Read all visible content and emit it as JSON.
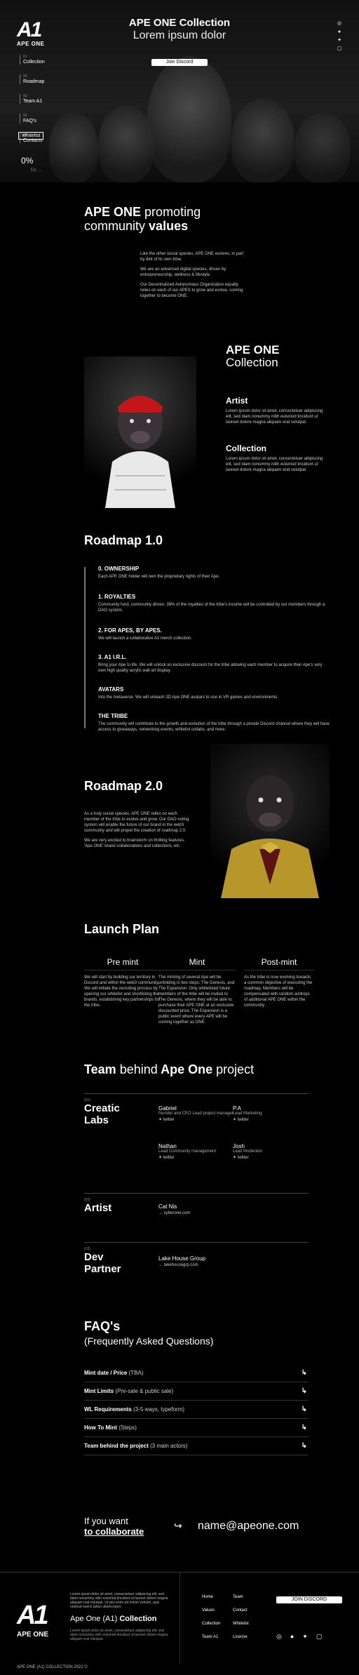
{
  "hero": {
    "logo_mark": "A1",
    "logo_text": "APE ONE",
    "title": "APE ONE Collection",
    "subtitle": "Lorem ipsum dolor",
    "join_label": "Join Discord",
    "whitelist_label": "Whitelist",
    "progress_label": "0%",
    "progress_value": 0,
    "progress_sub": "Ed. ...",
    "nav": [
      {
        "num": "01",
        "label": "Collection"
      },
      {
        "num": "02",
        "label": "Roadmap"
      },
      {
        "num": "03",
        "label": "Team A1"
      },
      {
        "num": "04",
        "label": "FAQ's"
      },
      {
        "num": "05",
        "label": "Contacts"
      }
    ]
  },
  "promo": {
    "title_a": "APE ONE",
    "title_b": "promoting",
    "title_c": "community",
    "title_d": "values",
    "p1": "Like the other social species, APE ONE evolves, in part by dint of its own tribe.",
    "p2": "We are an advanced digital species, driven by entrepreneurship, wellness & lifestyle.",
    "p3": "Our Decentralized Autonomous Organization equally relies on each of our APES to grow and evolve, coming together to become ONE."
  },
  "collection": {
    "title_a": "APE ONE",
    "title_b": "Collection",
    "artist_h": "Artist",
    "artist_t": "Lorem ipsum dolor sit amet, consectetuer adipiscing elit, sed diam nonummy nibh euismod tincidunt ut laoreet dolore magna aliquam erat volutpat.",
    "collection_h": "Collection",
    "collection_t": "Lorem ipsum dolor sit amet, consectetuer adipiscing elit, sed diam nonummy nibh euismod tincidunt ut laoreet dolore magna aliquam erat volutpat."
  },
  "roadmap1": {
    "title": "Roadmap 1.0",
    "items": [
      {
        "h": "0. OWNERSHIP",
        "t": "Each APE ONE holder will own the proprietary rights of their Ape."
      },
      {
        "h": "1. ROYALTIES",
        "t": "Community fund, community driven. 38% of the royalties of the tribe's income will be controlled by our members through a DAO system."
      },
      {
        "h": "2. FOR APES, BY APES.",
        "t": "We will launch a collaborative A1 merch collection."
      },
      {
        "h": "3. A1 I.R.L.",
        "t": "Bring your Ape to life. We will unlock an exclusive discount for the tribe allowing each member to acquire their Ape's very own high quality acrylic wall art display."
      },
      {
        "h": "AVATARS",
        "t": "Into the metaverse. We will unleash 3D Ape ONE avatars to use in VR games and environments."
      },
      {
        "h": "THE TRIBE",
        "t": "The community will contribute to the growth and evolution of the tribe through a private Discord channel where they will have access to giveaways, networking events, whitelist collabs, and more."
      }
    ]
  },
  "roadmap2": {
    "title": "Roadmap 2.0",
    "p1": "As a truly social species, APE ONE relies on each member of the tribe to evolve and grow. Our DAO voting system will enable the future of our brand in the web3 community and will propel the creation of roadmap 2.0.",
    "p2": "We are very excited to brainstorm on thrilling features. 'Ape ONE' brand collaborations and collections, etc."
  },
  "launch": {
    "title": "Launch Plan",
    "cols": [
      {
        "h": "Pre mint",
        "t": "We will start by building our territory in Discord and within the web3 community. We will initiate the recruiting process by opening our whitelist and shortlisting the brands, establishing key partnerships for the tribe."
      },
      {
        "h": "Mint",
        "t": "The minting of several Ape will be unfolding in two steps: The Genesis, and The Expansion. Only whitelisted future members of the tribe will be invited to The Genesis, where they will be able to purchase their APE ONE at an exclusive discounted price. The Expansion is a public event where every APE will be coming together as ONE."
      },
      {
        "h": "Post-mint",
        "t": "As the tribe is now evolving towards a common objective of executing the roadmap, Members will be compensated with random airdrops of additional APE ONE within the community."
      }
    ]
  },
  "team": {
    "title_a": "Team",
    "title_b": "behind",
    "title_c": "Ape One",
    "title_d": "project",
    "groups": [
      {
        "num": "(01)",
        "name": "Creatic Labs",
        "members": [
          {
            "n": "Gabriel",
            "r": "founder and CEO Lead project manager",
            "l": "twitter"
          },
          {
            "n": "P.A",
            "r": "Lead Marketing",
            "l": "twitter"
          },
          {
            "n": "Nathan",
            "r": "Lead Community management",
            "l": "twitter"
          },
          {
            "n": "Josh",
            "r": "Lead Moderator",
            "l": "twitter"
          }
        ]
      },
      {
        "num": "(02)",
        "name": "Artist",
        "members": [
          {
            "n": "Cat Nis",
            "r": "",
            "l": "cyberone.com"
          }
        ]
      },
      {
        "num": "(03)",
        "name": "Dev Partner",
        "members": [
          {
            "n": "Lake House Group",
            "r": "",
            "l": "lakehousegrp.com"
          }
        ]
      }
    ]
  },
  "faq": {
    "title": "FAQ's",
    "subtitle": "(Frequently Asked Questions)",
    "items": [
      {
        "q": "Mint date / Price",
        "n": "(TBA)"
      },
      {
        "q": "Mint Limits",
        "n": "(Pre-sale & public sale)"
      },
      {
        "q": "WL Requirements",
        "n": "(3-5 ways, typeform)"
      },
      {
        "q": "How To Mint",
        "n": "(Steps)"
      },
      {
        "q": "Team behind the project",
        "n": "(3 main actors)"
      }
    ]
  },
  "collab": {
    "line1": "If you want",
    "line2": "to collaborate",
    "email": "name@apeone.com"
  },
  "footer": {
    "logo_mark": "A1",
    "logo_text": "APE ONE",
    "text": "Lorem ipsum dolor sit amet, consectetuer adipiscing elit, sed diam nonummy nibh euismod tincidunt ut laoreet dolore magna aliquam erat volutpat. Ut wisi enim ad minim veniam, quis nostrud exerci tation ullamcorper.",
    "brand_a": "Ape One",
    "brand_b": "(A1)",
    "brand_c": "Collection",
    "small": "Lorem ipsum dolor sit amet, consectetuer adipiscing elit, sed diam nonummy nibh euismod tincidunt ut laoreet dolore magna aliquam erat volutpat.",
    "links": [
      "Home",
      "Team",
      "Values",
      "Contact",
      "Collection",
      "Whitelist",
      "Team A1",
      "License"
    ],
    "join_label": "JOIN DISCORD",
    "copyright": "APE ONE (A1) COLLECTION 2022 ©"
  }
}
